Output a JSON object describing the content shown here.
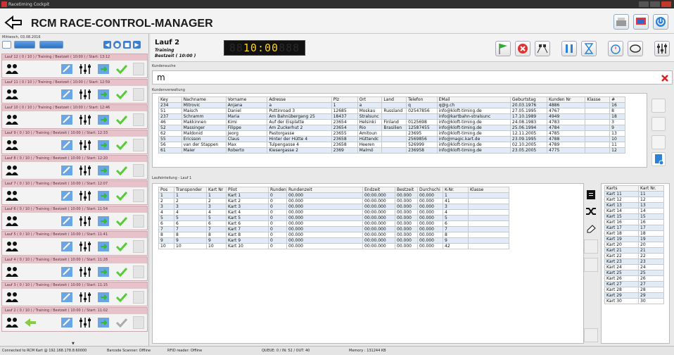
{
  "window": {
    "title": "Racetiming Cockpit"
  },
  "header": {
    "title": "RCM RACE-CONTROL-MANAGER"
  },
  "left": {
    "date": "Mittwoch, 03.08.2016",
    "races": [
      "Lauf 12 ( 0 / 10 ) / Training / Bestzeit ( 10:00 ) / Start: 13:12",
      "Lauf 11 ( 0 / 10 ) / Training / Bestzeit ( 10:00 ) / Start: 12:59",
      "Lauf 10 ( 0 / 10 ) / Training / Bestzeit ( 10:00 ) / Start: 12:46",
      "Lauf 9 ( 0 / 10 ) / Training / Bestzeit ( 10:00 ) / Start: 12:33",
      "Lauf 8 ( 0 / 10 ) / Training / Bestzeit ( 10:00 ) / Start: 12:20",
      "Lauf 7 ( 0 / 10 ) / Training / Bestzeit ( 10:00 ) / Start: 12:07",
      "Lauf 6 ( 0 / 10 ) / Training / Bestzeit ( 10:00 ) / Start: 11:54",
      "Lauf 5 ( 0 / 10 ) / Training / Bestzeit ( 10:00 ) / Start: 11:41",
      "Lauf 4 ( 0 / 10 ) / Training / Bestzeit ( 10:00 ) / Start: 11:28",
      "Lauf 3 ( 0 / 10 ) / Training / Bestzeit ( 10:00 ) / Start: 11:15",
      "Lauf 2 ( 0 / 10 ) / Training / Bestzeit ( 10:00 ) / Start: 11:02"
    ]
  },
  "lauf": {
    "name": "Lauf 2",
    "type": "Training",
    "mode": "Bestzeit ( 10:00 )",
    "clock_dim": "88",
    "clock": "10:00",
    "clock_dim2": "888"
  },
  "kundensuche": {
    "label": "Kundensuche",
    "value": "m"
  },
  "kundenverwaltung": {
    "label": "Kundenverwaltung",
    "columns": [
      "Key",
      "Nachname",
      "Vorname",
      "Adresse",
      "Plz",
      "Ort",
      "Land",
      "Telefon",
      "EMail",
      "Geburtstag",
      "Kunden Nr",
      "Klasse",
      "#"
    ],
    "rows": [
      [
        "234",
        "Mitrovic",
        "Anjana",
        "a",
        "1",
        "a",
        "",
        "q",
        "q@g.ch",
        "20.03.1976",
        "4886",
        "",
        "16"
      ],
      [
        "51",
        "Maisch",
        "Daniel",
        "Puttinroad 3",
        "12685",
        "Moskau",
        "Russland",
        "02547856",
        "info@kloft-timing.de",
        "27.05.1995",
        "4767",
        "",
        "8"
      ],
      [
        "237",
        "Schramm",
        "Maria",
        "Am Bahnübergang 25",
        "18437",
        "Stralsunc",
        "",
        "",
        "info@kartbahn-stralsunc",
        "17.10.1989",
        "4949",
        "",
        "18"
      ],
      [
        "46",
        "Makkinnen",
        "Kimi",
        "Auf der Eisplatte",
        "23654",
        "Helsinki",
        "Finland",
        "0125698",
        "info@kloft-timing.de",
        "24.08.1983",
        "4783",
        "",
        "3"
      ],
      [
        "52",
        "Massinger",
        "Filippe",
        "Am Zuckerhut 2",
        "23654",
        "Rio",
        "Brasilien",
        "12587455",
        "info@kloft-timing.de",
        "25.06.1994",
        "4784",
        "",
        "9"
      ],
      [
        "62",
        "Maldonid",
        "Jeorg",
        "Pastorgasse",
        "23655",
        "Amitoun",
        "",
        "23695",
        "info@kloft-timing.de",
        "12.11.2005",
        "4785",
        "",
        "13"
      ],
      [
        "55",
        "Ericsson",
        "Claus",
        "Hinter der Hütte 4",
        "23658",
        "Hüttendc",
        "",
        "2569856",
        "info@magic.kart.de",
        "23.09.1995",
        "4788",
        "",
        "10"
      ],
      [
        "56",
        "van der Stappen",
        "Max",
        "Tulpengasse 4",
        "23658",
        "Heeren",
        "",
        "526999",
        "info@kloft-timing.de",
        "02.10.2005",
        "4789",
        "",
        "11"
      ],
      [
        "61",
        "Maier",
        "Roberto",
        "Kiesergasse 2",
        "2369",
        "Malmö",
        "",
        "236958",
        "info@kloft-timing.de",
        "23.05.2005",
        "4775",
        "",
        "12"
      ]
    ]
  },
  "laufeinteilung": {
    "label": "Laufeinteilung - Lauf 1",
    "columns": [
      "Pos",
      "Transponder",
      "Kart Nr",
      "Pilot",
      "Runden",
      "Rundenzeit",
      "Endzeit",
      "Bestzeit",
      "Durchschi",
      "K-Nr.",
      "Klasse"
    ],
    "rows": [
      [
        "1",
        "1",
        "1",
        "Kart 1",
        "0",
        "00.000",
        "00:00.000",
        "00.000",
        "00.000",
        "1",
        ""
      ],
      [
        "2",
        "2",
        "2",
        "Kart 2",
        "0",
        "00.000",
        "00:00.000",
        "00.000",
        "00.000",
        "41",
        ""
      ],
      [
        "3",
        "3",
        "3",
        "Kart 3",
        "0",
        "00.000",
        "00:00.000",
        "00.000",
        "00.000",
        "3",
        ""
      ],
      [
        "4",
        "4",
        "4",
        "Kart 4",
        "0",
        "00.000",
        "00:00.000",
        "00.000",
        "00.000",
        "4",
        ""
      ],
      [
        "5",
        "5",
        "5",
        "Kart 5",
        "0",
        "00.000",
        "00:00.000",
        "00.000",
        "00.000",
        "5",
        ""
      ],
      [
        "6",
        "6",
        "6",
        "Kart 6",
        "0",
        "00.000",
        "00:00.000",
        "00.000",
        "00.000",
        "6",
        ""
      ],
      [
        "7",
        "7",
        "7",
        "Kart 7",
        "0",
        "00.000",
        "00:00.000",
        "00.000",
        "00.000",
        "7",
        ""
      ],
      [
        "8",
        "8",
        "8",
        "Kart 8",
        "0",
        "00.000",
        "00:00.000",
        "00.000",
        "00.000",
        "8",
        ""
      ],
      [
        "9",
        "9",
        "9",
        "Kart 9",
        "0",
        "00.000",
        "00:00.000",
        "00.000",
        "00.000",
        "9",
        ""
      ],
      [
        "10",
        "10",
        "10",
        "Kart 10",
        "0",
        "00.000",
        "00:00.000",
        "00.000",
        "00.000",
        "42",
        ""
      ]
    ]
  },
  "karts": {
    "columns": [
      "Karts",
      "Kart Nr."
    ],
    "rows": [
      [
        "Kart 11",
        "11"
      ],
      [
        "Kart 12",
        "12"
      ],
      [
        "Kart 13",
        "13"
      ],
      [
        "Kart 14",
        "14"
      ],
      [
        "Kart 15",
        "15"
      ],
      [
        "Kart 16",
        "16"
      ],
      [
        "Kart 17",
        "17"
      ],
      [
        "Kart 18",
        "18"
      ],
      [
        "Kart 19",
        "19"
      ],
      [
        "Kart 20",
        "20"
      ],
      [
        "Kart 21",
        "21"
      ],
      [
        "Kart 22",
        "22"
      ],
      [
        "Kart 23",
        "23"
      ],
      [
        "Kart 24",
        "24"
      ],
      [
        "Kart 25",
        "25"
      ],
      [
        "Kart 26",
        "26"
      ],
      [
        "Kart 27",
        "27"
      ],
      [
        "Kart 28",
        "28"
      ],
      [
        "Kart 29",
        "29"
      ],
      [
        "Kart 30",
        "30"
      ]
    ]
  },
  "status": {
    "connection": "Connected to RCM Kart @ 192.168.178.8:60000",
    "barcode": "Barcode Scanner: Offline",
    "rfid": "RFID reader: Offline",
    "queue": "QUEUE: 0 / IN: 52 / OUT: 40",
    "memory": "Memory : 131244 KB"
  },
  "colors": {
    "accent": "#2e6fc0",
    "race_header": "#e8c2cb",
    "alt_row": "#e2ecf7",
    "clock_digit": "#ffd21a"
  }
}
